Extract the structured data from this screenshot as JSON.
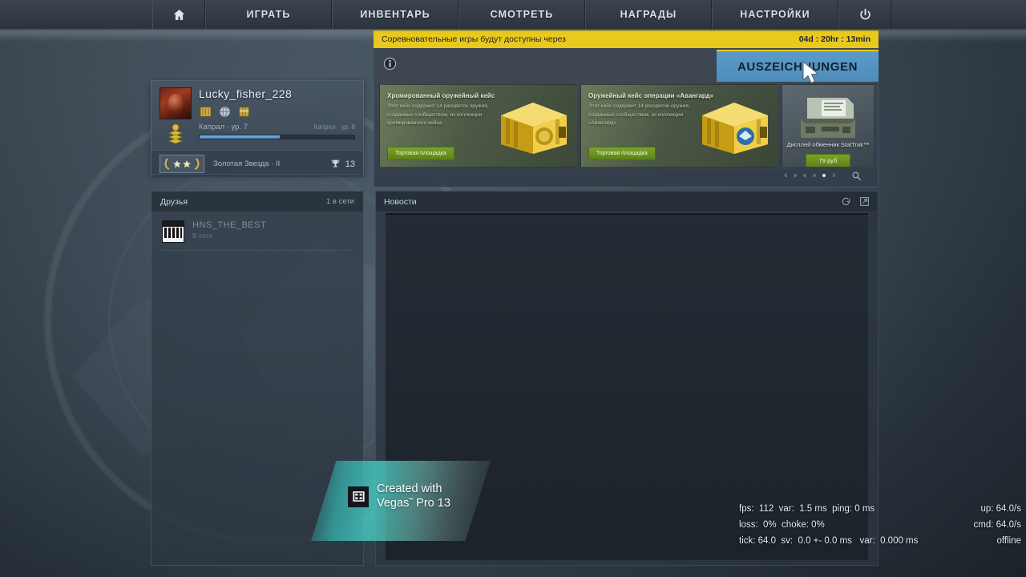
{
  "nav": {
    "home_icon": "home-icon",
    "items": [
      {
        "label": "ИГРАТЬ",
        "name": "nav-play"
      },
      {
        "label": "ИНВЕНТАРЬ",
        "name": "nav-inventory"
      },
      {
        "label": "СМОТРЕТЬ",
        "name": "nav-watch"
      },
      {
        "label": "НАГРАДЫ",
        "name": "nav-awards"
      },
      {
        "label": "НАСТРОЙКИ",
        "name": "nav-settings"
      }
    ],
    "power_icon": "power-icon"
  },
  "timer": {
    "text": "Соревновательные игры будут доступны через",
    "value": "04d : 20hr : 13min",
    "bar_color": "#e9c91d"
  },
  "info_bar": {
    "info_icon": "info-icon"
  },
  "tooltip": {
    "label": "AUSZEICHNUNGEN",
    "accent": "#4e8dbb"
  },
  "carousel": {
    "cards": [
      {
        "title": "Хромированный оружейный кейс",
        "desc": "Этот кейс содержит 14 расцветок оружия, созданных сообществом, из коллекции хромированного кейса",
        "button": "Торговая площадка"
      },
      {
        "title": "Оружейный кейс операции «Авангард»",
        "desc": "Этот кейс содержит 14 расцветок оружия, созданных сообществом, из коллекции «Авангард»",
        "button": "Торговая площадка"
      },
      {
        "title": "Дисплей обменник StatTrak™",
        "button": "79 руб"
      }
    ],
    "prev_arrow": "‹",
    "next_arrow": "›",
    "dot_count": 4,
    "active_dot": 3,
    "search_icon": "magnifier-icon"
  },
  "profile": {
    "username": "Lucky_fisher_228",
    "avatar_name": "player-avatar",
    "badges": [
      "badge-icon-1",
      "badge-icon-2",
      "badge-icon-3"
    ],
    "rank_icon": "corporal-chevron-icon",
    "rank_current": "Капрал · ур. 7",
    "rank_next": "Капрал · ур. 8",
    "xp_percent": 52,
    "medal_icon": "gold-star-medal-icon",
    "medal_label": "Золотая Звезда · II",
    "trophy_icon": "trophy-icon",
    "trophy_count": "13"
  },
  "friends": {
    "title": "Друзья",
    "online_count": "1 в сети",
    "list": [
      {
        "name": "HNS_THE_BEST",
        "status": "В сети",
        "avatar": "friend-avatar"
      }
    ]
  },
  "news": {
    "title": "Новости",
    "refresh_icon": "refresh-icon",
    "popout_icon": "external-link-icon"
  },
  "netgraph": {
    "rows": [
      {
        "left": "fps:  112  var:  1.5 ms  ping: 0 ms",
        "right": "up: 64.0/s"
      },
      {
        "left": "loss:  0%  choke: 0%",
        "right": "cmd: 64.0/s"
      },
      {
        "left": "tick: 64.0  sv:  0.0 +- 0.0 ms   var:  0.000 ms",
        "right": "offline"
      }
    ]
  },
  "watermark": {
    "line1": "Created with",
    "line2": "Vegas˜ Pro 13",
    "icon": "film-strip-icon"
  },
  "cursor": {
    "name": "mouse-cursor"
  }
}
